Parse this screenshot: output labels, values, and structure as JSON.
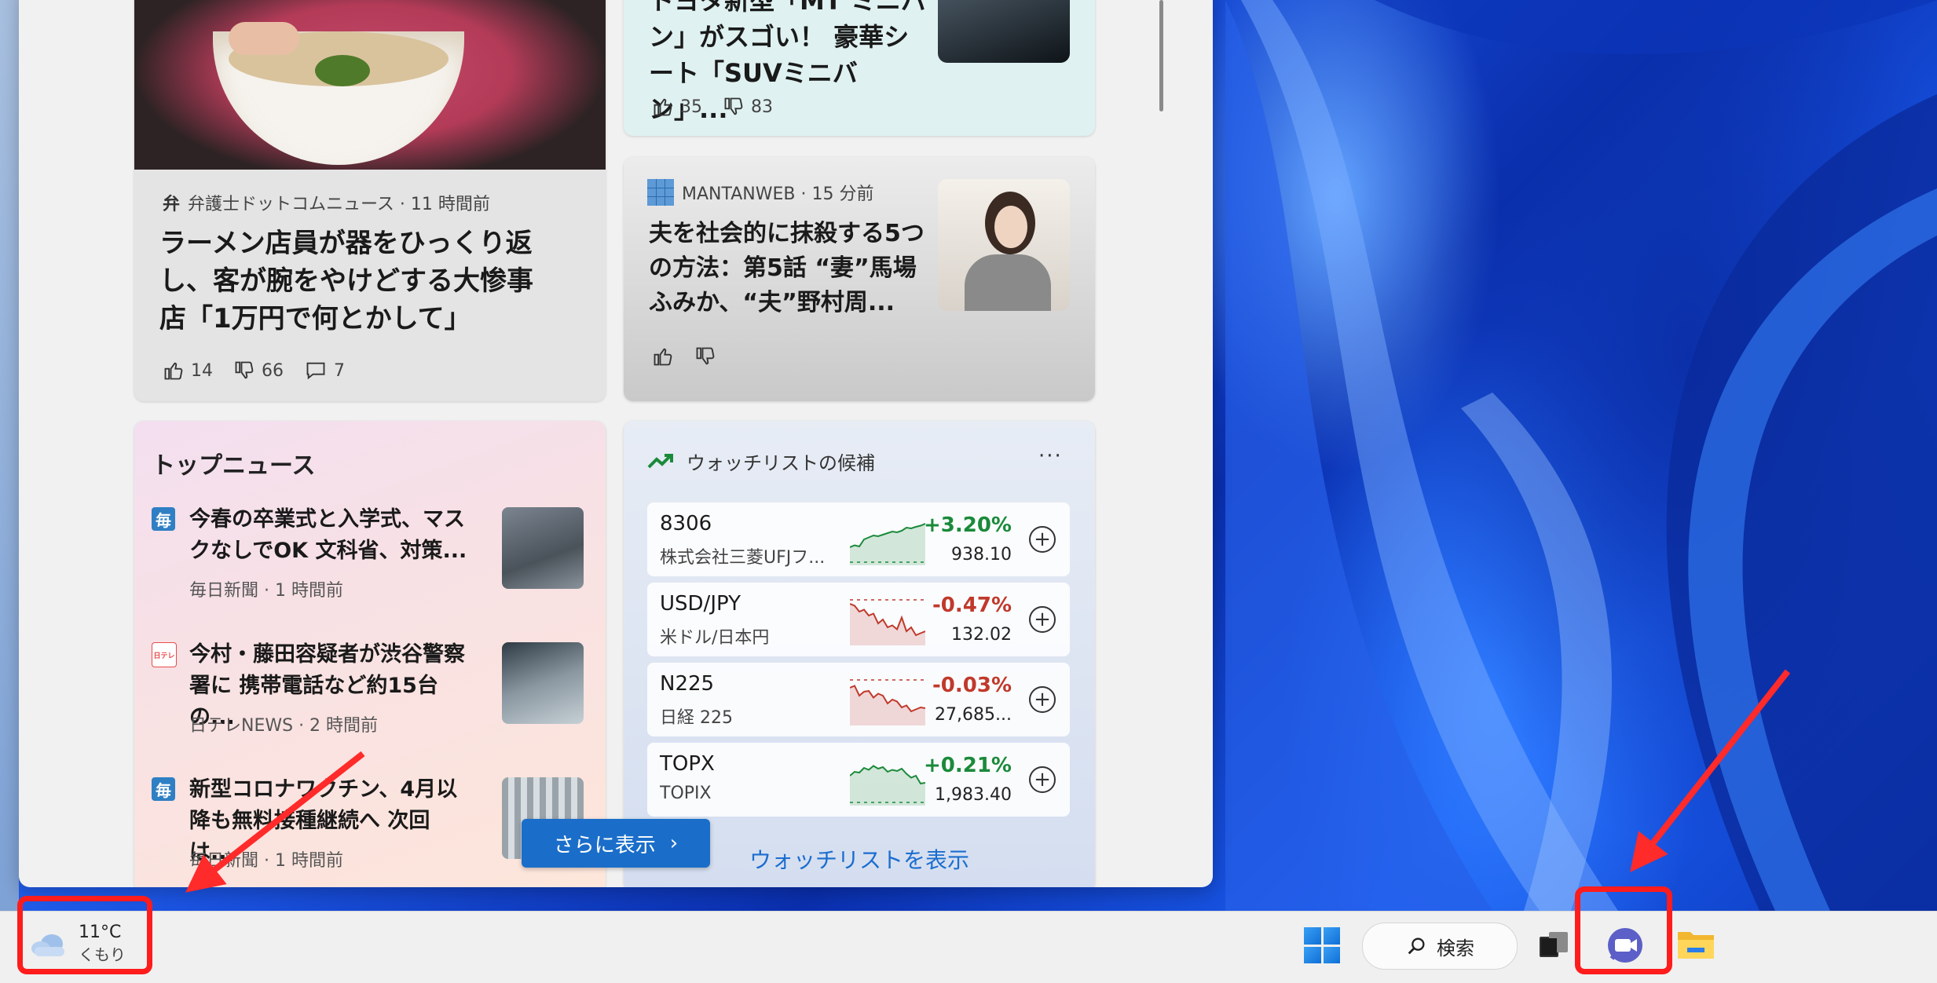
{
  "feed": {
    "card_toyota": {
      "title": "トヨタ新型「MT ミニバン」がスゴい！ 豪華シート「SUVミニバン」...",
      "likes": "35",
      "dislikes": "83"
    },
    "card_ramen": {
      "source": "弁護士ドットコムニュース · 11 時間前",
      "source_logo": "弁",
      "title": "ラーメン店員が器をひっくり返し、客が腕をやけどする大惨事 店「1万円で何とかして」",
      "likes": "14",
      "dislikes": "66",
      "comments": "7"
    },
    "card_mantan": {
      "source": "MANTANWEB · 15 分前",
      "title": "夫を社会的に抹殺する5つの方法：第5話 “妻”馬場ふみか、“夫”野村周..."
    }
  },
  "top_news": {
    "heading": "トップニュース",
    "items": [
      {
        "icon": "毎",
        "icon_color": "#2f7fc4",
        "title": "今春の卒業式と入学式、マスクなしでOK 文科省、対策...",
        "meta": "毎日新聞 · 1 時間前"
      },
      {
        "icon": "日テレ",
        "icon_color": "#e94b4b",
        "title": "今村・藤田容疑者が渋谷警察署に 携帯電話など約15台の...",
        "meta": "日テレNEWS · 2 時間前"
      },
      {
        "icon": "毎",
        "icon_color": "#2f7fc4",
        "title": "新型コロナワクチン、4月以降も無料接種継続へ 次回は...",
        "meta": "毎日新聞 · 1 時間前"
      }
    ]
  },
  "watchlist": {
    "heading": "ウォッチリストの候補",
    "more": "···",
    "link": "ウォッチリストを表示",
    "stocks": [
      {
        "symbol": "8306",
        "name": "株式会社三菱UFJフ...",
        "change": "+3.20%",
        "price": "938.10",
        "trend": "up",
        "points": [
          0.3,
          0.35,
          0.32,
          0.5,
          0.55,
          0.6,
          0.58,
          0.62,
          0.66,
          0.7,
          0.68,
          0.72,
          0.8,
          0.78,
          0.82,
          0.85,
          0.9
        ]
      },
      {
        "symbol": "USD/JPY",
        "name": "米ドル/日本円",
        "change": "-0.47%",
        "price": "132.02",
        "trend": "down",
        "points": [
          0.9,
          0.85,
          0.7,
          0.75,
          0.6,
          0.65,
          0.4,
          0.5,
          0.3,
          0.35,
          0.25,
          0.55,
          0.2,
          0.3,
          0.1,
          0.15,
          0.2
        ]
      },
      {
        "symbol": "N225",
        "name": "日経 225",
        "change": "-0.03%",
        "price": "27,685...",
        "trend": "down",
        "points": [
          0.8,
          0.85,
          0.6,
          0.7,
          0.72,
          0.55,
          0.65,
          0.6,
          0.4,
          0.5,
          0.45,
          0.3,
          0.35,
          0.2,
          0.25,
          0.3,
          0.28
        ]
      },
      {
        "symbol": "TOPX",
        "name": "TOPIX",
        "change": "+0.21%",
        "price": "1,983.40",
        "trend": "up",
        "points": [
          0.6,
          0.7,
          0.68,
          0.8,
          0.75,
          0.85,
          0.78,
          0.82,
          0.7,
          0.75,
          0.72,
          0.78,
          0.65,
          0.55,
          0.6,
          0.4,
          0.42
        ]
      }
    ],
    "colors": {
      "up": "#1a8a3a",
      "down": "#c0392b"
    }
  },
  "see_more": {
    "label": "さらに表示"
  },
  "taskbar": {
    "weather": {
      "temp": "11°C",
      "condition": "くもり"
    },
    "search_label": "検索"
  }
}
